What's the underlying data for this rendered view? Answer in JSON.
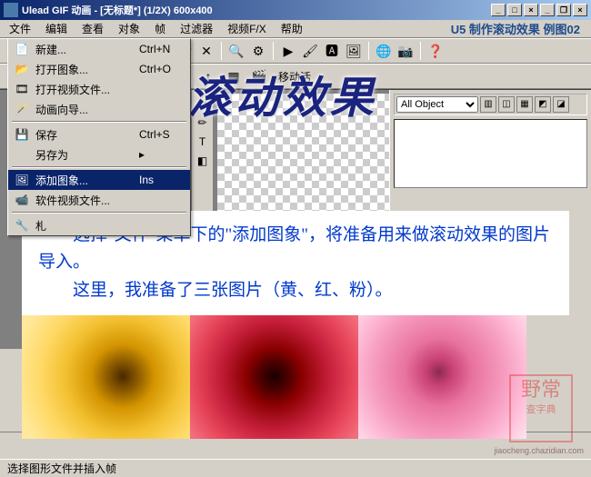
{
  "title": "Ulead GIF 动画 - [无标题*] (1/2X) 600x400",
  "header_right": "U5 制作滚动效果 例图02",
  "menu": [
    "文件",
    "编辑",
    "查看",
    "对象",
    "帧",
    "过滤器",
    "视频F/X",
    "帮助"
  ],
  "file_menu": {
    "new": {
      "label": "新建...",
      "shortcut": "Ctrl+N"
    },
    "open": {
      "label": "打开图象...",
      "shortcut": "Ctrl+O"
    },
    "openvid": {
      "label": "打开视频文件...",
      "shortcut": ""
    },
    "anim": {
      "label": "动画向导...",
      "shortcut": ""
    },
    "save": {
      "label": "保存",
      "shortcut": "Ctrl+S"
    },
    "saveas": {
      "label": "另存为",
      "shortcut": ""
    },
    "addimg": {
      "label": "添加图象...",
      "shortcut": "Ins"
    },
    "swvid": {
      "label": "软件视频文件...",
      "shortcut": ""
    }
  },
  "secondbar": {
    "move": "移动活"
  },
  "right_panel": {
    "all_objects": "All Object"
  },
  "big_title": "U5 制作滚动效果",
  "instruction": {
    "line1": "选择\"文件\"菜单下的\"添加图象\"，将准备用来做滚动效果的图片导入。",
    "line2": "这里，我准备了三张图片（黄、红、粉）。"
  },
  "watermark": {
    "text": "野常",
    "brand": "查字典",
    "url": "jiaocheng.chazidian.com"
  },
  "status": "选择图形文件并插入帧",
  "win": {
    "min": "_",
    "max": "□",
    "close": "×",
    "min2": "_",
    "restore": "❐",
    "close2": "×"
  }
}
